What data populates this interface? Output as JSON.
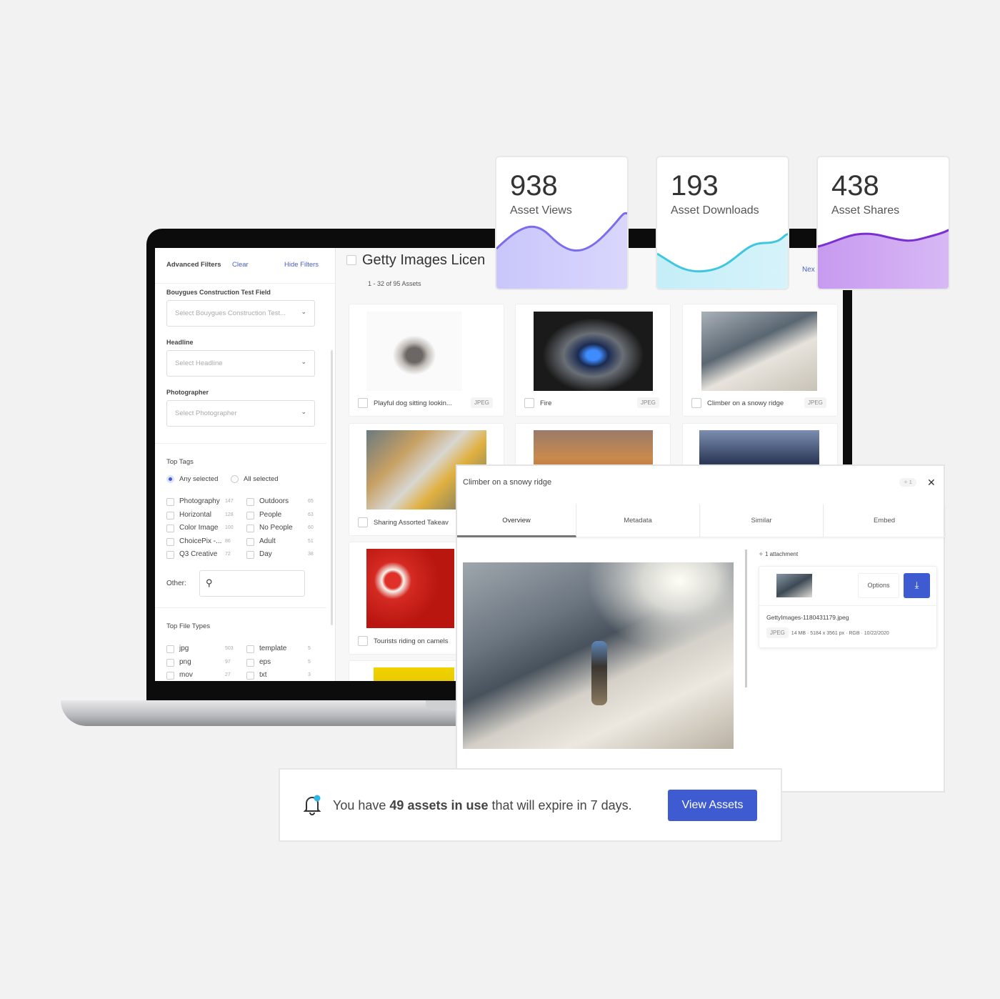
{
  "stats": [
    {
      "value": "938",
      "label": "Asset Views",
      "color": "#7b6cf0",
      "fill": "#c9c6fb"
    },
    {
      "value": "193",
      "label": "Asset Downloads",
      "color": "#3fc7e0",
      "fill": "#c5eef8"
    },
    {
      "value": "438",
      "label": "Asset Shares",
      "color": "#7a2fd0",
      "fill": "#c79af0"
    }
  ],
  "filters": {
    "title": "Advanced Filters",
    "clear": "Clear",
    "hide": "Hide Filters",
    "fields": [
      {
        "label": "Bouygues Construction Test Field",
        "placeholder": "Select Bouygues Construction Test..."
      },
      {
        "label": "Headline",
        "placeholder": "Select Headline"
      },
      {
        "label": "Photographer",
        "placeholder": "Select Photographer"
      }
    ],
    "top_tags": "Top Tags",
    "any_selected": "Any selected",
    "all_selected": "All selected",
    "tags_left": [
      {
        "name": "Photography",
        "count": "147"
      },
      {
        "name": "Horizontal",
        "count": "128"
      },
      {
        "name": "Color Image",
        "count": "100"
      },
      {
        "name": "ChoicePix -...",
        "count": "86"
      },
      {
        "name": "Q3 Creative",
        "count": "72"
      }
    ],
    "tags_right": [
      {
        "name": "Outdoors",
        "count": "65"
      },
      {
        "name": "People",
        "count": "63"
      },
      {
        "name": "No People",
        "count": "60"
      },
      {
        "name": "Adult",
        "count": "51"
      },
      {
        "name": "Day",
        "count": "38"
      }
    ],
    "other_label": "Other:",
    "top_file_types": "Top File Types",
    "types_left": [
      {
        "name": "jpg",
        "count": "503"
      },
      {
        "name": "png",
        "count": "97"
      },
      {
        "name": "mov",
        "count": "27"
      }
    ],
    "types_right": [
      {
        "name": "template",
        "count": "5"
      },
      {
        "name": "eps",
        "count": "5"
      },
      {
        "name": "txt",
        "count": "3"
      }
    ]
  },
  "main": {
    "title": "Getty Images Licen",
    "count": "1 - 32 of 95 Assets",
    "next": "Nex",
    "assets": [
      {
        "name": "Playful dog sitting lookin...",
        "type": "JPEG"
      },
      {
        "name": "Fire",
        "type": "JPEG"
      },
      {
        "name": "Climber on a snowy ridge",
        "type": "JPEG"
      },
      {
        "name": "Sharing Assorted Takeav"
      },
      {
        "name": "Tourists riding on camels"
      }
    ]
  },
  "modal": {
    "title": "Climber on a snowy ridge",
    "pin_count": "1",
    "tabs": [
      "Overview",
      "Metadata",
      "Similar",
      "Embed"
    ],
    "attachments": "1 attachment",
    "options": "Options",
    "filename": "GettyImages-1180431179.jpeg",
    "meta": [
      "JPEG",
      "14 MB",
      "5184 x 3561 px",
      "RGB",
      "10/22/2020"
    ]
  },
  "notification": {
    "pre": "You have ",
    "bold": "49 assets in use",
    "post": " that will expire in 7 days.",
    "button": "View Assets",
    "accent": "#3f5bd1"
  }
}
